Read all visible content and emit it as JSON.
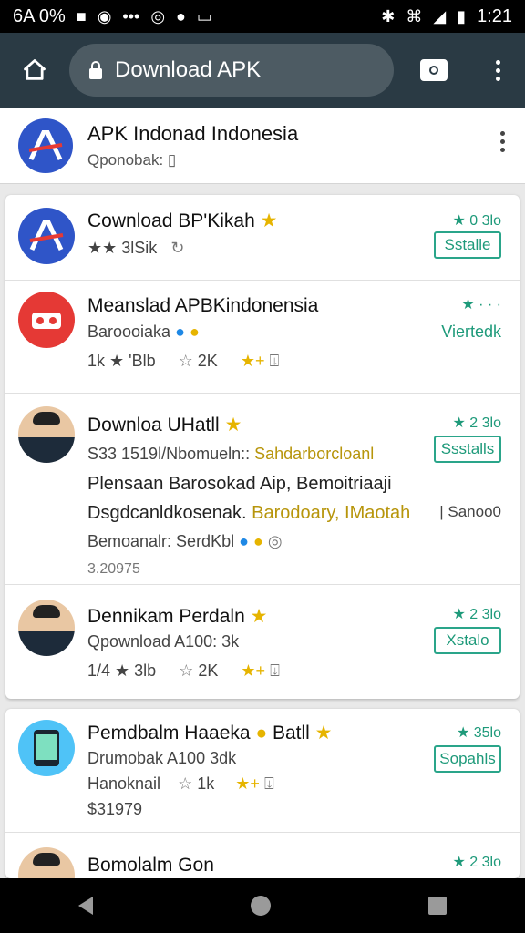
{
  "status_bar": {
    "left_text": "6A 0% ",
    "icons_left": [
      "n-icon",
      "wifi-icon",
      "more-icon",
      "clock-icon",
      "app-icon",
      "card-icon"
    ],
    "time": "1:21",
    "icons_right": [
      "bluetooth-icon",
      "vibrate-icon",
      "signal-icon",
      "battery-icon"
    ]
  },
  "browser": {
    "url_text": "Download APK"
  },
  "site": {
    "title": "APK Indonad Indonesia",
    "subtitle": "Qponobak: "
  },
  "card1": {
    "items": [
      {
        "name": "Cownload BP'Kikah",
        "rating": "★ 0 3lo",
        "button": "Sstalle",
        "line1": "★★ 3lSik",
        "extra": ""
      },
      {
        "name": "Meanslad APBKindonensia",
        "rating": "★ · · ·",
        "button": "Viertedk",
        "line1": "Baroooiaka",
        "line2_a": "1k ★ 'Blb",
        "line2_b": "2K"
      },
      {
        "name": "Downloa UHatll",
        "rating": "★ 2 3lo",
        "button": "Ssstalls",
        "line1_a": "S33 1519l/Nbomueln::",
        "line1_b": "Sahdarborcloanl",
        "line2": "Plensaan Barosokad Aip, Bemoitriaaji",
        "line3_a": "Dsgdcanldkosenak.",
        "line3_b": "Barodoary, IMaotah",
        "line3_c": "| Sanoo0",
        "line4": "Bemoanalr: SerdKbl",
        "line5": "3.20975"
      },
      {
        "name": "Dennikam Perdaln",
        "rating": "★ 2 3lo",
        "button": "Xstalo",
        "line1": "Qpownload A100: 3k",
        "line2_a": "1/4 ★ 3lb",
        "line2_b": "2K"
      }
    ]
  },
  "card2": {
    "items": [
      {
        "name": "Pemdbalm Haaeka",
        "name_b": "Batll",
        "rating": "★ 35lo",
        "button": "Sopahls",
        "line1": "Drumobak A100 3dk",
        "line2": "Hanoknail",
        "line2_b": "1k",
        "line3": "$31979"
      },
      {
        "name": "Bomolalm Gon",
        "rating": "★ 2 3lo"
      }
    ]
  },
  "colors": {
    "toolbar": "#2a3a44",
    "urlbar": "#4d5b63",
    "accent": "#1e9a7a",
    "logo_blue": "#2f55c8",
    "red_logo": "#e53935"
  }
}
